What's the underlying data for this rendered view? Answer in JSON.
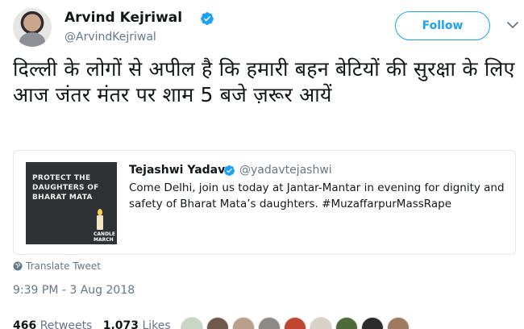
{
  "author": {
    "name": "Arvind Kejriwal",
    "handle": "@ArvindKejriwal",
    "verified": true
  },
  "follow_label": "Follow",
  "tweet_text": "दिल्ली के लोगों से अपील है कि हमारी बहन बेटियों की सुरक्षा के लिए आज जंतर मंतर पर शाम 5 बजे ज़रूर आयें",
  "quoted_tweet": {
    "name": "Tejashwi Yadav",
    "handle": "@yadavtejashwi",
    "verified": true,
    "text": "Come Delhi, join us today at Jantar-Mantar in evening for dignity and safety of Bharat Mata’s daughters. #MuzaffarpurMassRape",
    "image_caption": "PROTECT THE DAUGHTERS OF BHARAT MATA",
    "image_label": "CANDLE MARCH"
  },
  "translate_label": "Translate Tweet",
  "timestamp": "9:39 PM - 3 Aug 2018",
  "stats": {
    "retweets_count": "466",
    "retweets_label": "Retweets",
    "likes_count": "1,073",
    "likes_label": "Likes"
  },
  "colors": {
    "accent": "#1da1f2",
    "secondary_text": "#657786"
  },
  "icons": [
    "verified-badge-icon",
    "chevron-down-icon",
    "globe-icon"
  ]
}
